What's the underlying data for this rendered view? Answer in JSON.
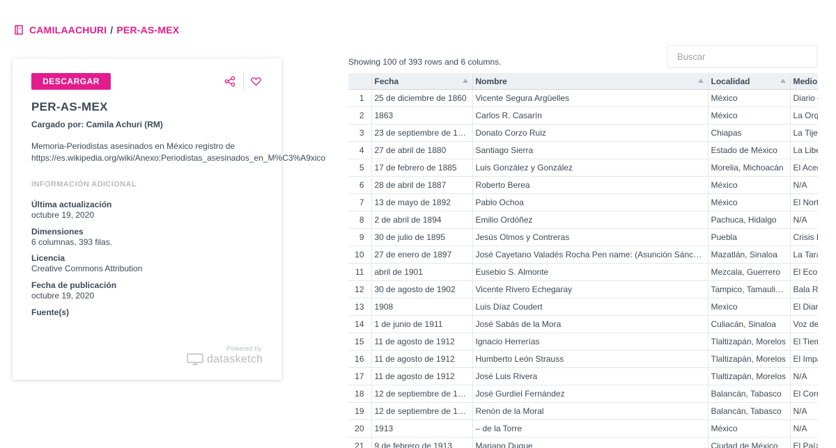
{
  "breadcrumb": {
    "owner": "CAMILAACHURI",
    "separator": "/",
    "dataset": "PER-AS-MEX"
  },
  "card": {
    "download_label": "DESCARGAR",
    "title": "PER-AS-MEX",
    "uploaded_by": "Cargado por: Camila Achuri (RM)",
    "description_line1": "Memoria-Periodistas asesinados en México registro de",
    "description_line2": "https://es.wikipedia.org/wiki/Anexo:Periodistas_asesinados_en_M%C3%A9xico",
    "additional_heading": "INFORMACIÓN ADICIONAL",
    "last_updated_label": "Última actualización",
    "last_updated_value": "octubre 19, 2020",
    "dimensions_label": "Dimensiones",
    "dimensions_value": "6 columnas, 393 filas.",
    "license_label": "Licencia",
    "license_value": "Creative Commons Attribution",
    "published_label": "Fecha de publicación",
    "published_value": "octubre 19, 2020",
    "sources_label": "Fuente(s)",
    "powered_by": "Powered by",
    "brand": "datasketch",
    "icons": {
      "share": "share-icon",
      "like": "heart-icon",
      "book": "book-icon"
    },
    "accent_color": "#e31c8d"
  },
  "table": {
    "info": "Showing 100 of 393 rows and 6 columns.",
    "search_placeholder": "Buscar",
    "columns": [
      "",
      "Fecha",
      "Nombre",
      "Localidad",
      "Medio"
    ],
    "rows": [
      [
        "1",
        "25 de diciembre de 1860",
        "Vicente Segura Argüelles",
        "México",
        "Diario d"
      ],
      [
        "2",
        "1863",
        "Carlos R. Casarín",
        "México",
        "La Orqu"
      ],
      [
        "3",
        "23 de septiembre de 18...",
        "Donato Corzo Ruiz",
        "Chiapas",
        "La Tijer"
      ],
      [
        "4",
        "27 de abril de 1880",
        "Santiago Sierra",
        "Estado de México",
        "La Liber"
      ],
      [
        "5",
        "17 de febrero de 1885",
        "Luis González y González",
        "Morelia, Michoacán",
        "El Acer"
      ],
      [
        "6",
        "28 de abril de 1887",
        "Roberto Berea",
        "México",
        "N/A"
      ],
      [
        "7",
        "13 de mayo de 1892",
        "Pablo Ochoa",
        "México",
        "El Nort"
      ],
      [
        "8",
        "2 de abril de 1894",
        "Emilio Ordóñez",
        "Pachuca, Hidalgo",
        "N/A"
      ],
      [
        "9",
        "30 de julio de 1895",
        "Jesús Olmos y Contreras",
        "Puebla",
        "Crisis L"
      ],
      [
        "10",
        "27 de enero de 1897",
        "José Cayetano Valadés Rocha Pen name: (Asunción Sánchez)",
        "Mazatlán, Sinaloa",
        "La Tará"
      ],
      [
        "11",
        "abril de 1901",
        "Eusebio S. Almonte",
        "Mezcala, Guerrero",
        "El Eco d"
      ],
      [
        "12",
        "30 de agosto de 1902",
        "Vicente Rivero Echegaray",
        "Tampico, Tamaulip...",
        "Bala Ra"
      ],
      [
        "13",
        "1908",
        "Luis Díaz Coudert",
        "Mexico",
        "El Diari"
      ],
      [
        "14",
        "1 de junio de 1911",
        "José Sabás de la Mora",
        "Culiacán, Sinaloa",
        "Voz de"
      ],
      [
        "15",
        "11 de agosto de 1912",
        "Ignacio Herrerías",
        "Tlaltizapán, Morelos",
        "El Tiem"
      ],
      [
        "16",
        "11 de agosto de 1912",
        "Humberto León Strauss",
        "Tlaltizapán, Morelos",
        "El Impa"
      ],
      [
        "17",
        "11 de agosto de 1912",
        "José Luis Rivera",
        "Tlaltizapán, Morelos",
        "N/A"
      ],
      [
        "18",
        "12 de septiembre de 19...",
        "José Gurdiel Fernández",
        "Balancán, Tabasco",
        "El Corr"
      ],
      [
        "19",
        "12 de septiembre de 19...",
        "Renón de la Moral",
        "Balancán, Tabasco",
        "N/A"
      ],
      [
        "20",
        "1913",
        "– de la Torre",
        "México",
        "N/A"
      ],
      [
        "21",
        "9 de febrero de 1913",
        "Mariano Duque",
        "Ciudad de México",
        "El Paíz"
      ]
    ]
  }
}
